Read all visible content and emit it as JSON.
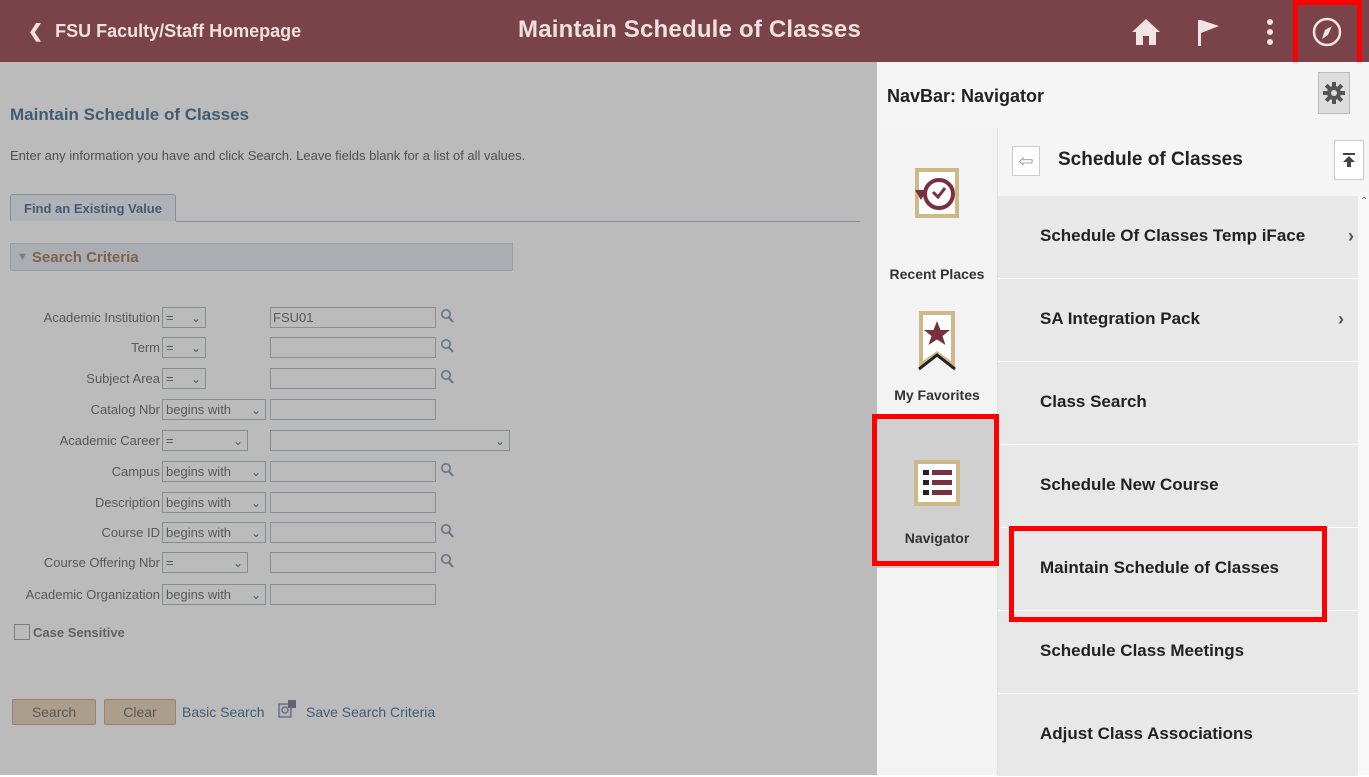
{
  "header": {
    "back_label": "FSU Faculty/Staff Homepage",
    "title": "Maintain Schedule of Classes",
    "icons": [
      "home-icon",
      "flag-icon",
      "more-vertical-icon",
      "compass-icon"
    ]
  },
  "main": {
    "page_title": "Maintain Schedule of Classes",
    "instructions": "Enter any information you have and click Search. Leave fields blank for a list of all values.",
    "tab": "Find an Existing Value",
    "section": "Search Criteria",
    "fields": [
      {
        "label": "Academic Institution",
        "op": "=",
        "value": "FSU01",
        "lookup": true
      },
      {
        "label": "Term",
        "op": "=",
        "value": "",
        "lookup": true
      },
      {
        "label": "Subject Area",
        "op": "=",
        "value": "",
        "lookup": true
      },
      {
        "label": "Catalog Nbr",
        "op": "begins with",
        "value": "",
        "lookup": false
      },
      {
        "label": "Academic Career",
        "op": "=",
        "value": "",
        "lookup": false
      },
      {
        "label": "Campus",
        "op": "begins with",
        "value": "",
        "lookup": true
      },
      {
        "label": "Description",
        "op": "begins with",
        "value": "",
        "lookup": false
      },
      {
        "label": "Course ID",
        "op": "begins with",
        "value": "",
        "lookup": true
      },
      {
        "label": "Course Offering Nbr",
        "op": "=",
        "value": "",
        "lookup": true
      },
      {
        "label": "Academic Organization",
        "op": "begins with",
        "value": "",
        "lookup": false
      }
    ],
    "case_sensitive": "Case Sensitive",
    "search_button": "Search",
    "clear_button": "Clear",
    "basic_search": "Basic Search",
    "save_criteria": "Save Search Criteria"
  },
  "nav": {
    "title": "NavBar: Navigator",
    "side": {
      "recent": "Recent Places",
      "favorites": "My Favorites",
      "navigator": "Navigator"
    },
    "list_title": "Schedule of Classes",
    "items": [
      {
        "label": "Schedule Of Classes Temp iFace",
        "arrow": "›"
      },
      {
        "label": "SA Integration Pack",
        "arrow": "›"
      },
      {
        "label": "Class Search",
        "arrow": ""
      },
      {
        "label": "Schedule New Course",
        "arrow": ""
      },
      {
        "label": "Maintain Schedule of Classes",
        "arrow": ""
      },
      {
        "label": "Schedule Class Meetings",
        "arrow": ""
      },
      {
        "label": "Adjust Class Associations",
        "arrow": ""
      }
    ]
  },
  "colors": {
    "header_bg": "#7a4349",
    "highlight": "#ff0000",
    "fsu_garnet": "#782f40",
    "fsu_gold": "#ceb888"
  }
}
